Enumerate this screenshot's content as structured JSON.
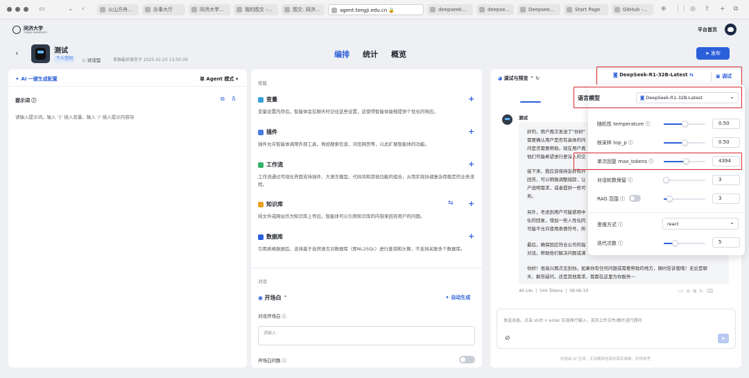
{
  "browser": {
    "tabs": [
      {
        "label": "火山方舟..."
      },
      {
        "label": "办事大厅"
      },
      {
        "label": "同济大学..."
      },
      {
        "label": "我的图文 -..."
      },
      {
        "label": "图文: 同济..."
      },
      {
        "label": "agent.tongji.edu.cn 🔒"
      },
      {
        "label": "deepseek..."
      },
      {
        "label": "deepse..."
      },
      {
        "label": "Deepsee..."
      },
      {
        "label": "Start Page"
      },
      {
        "label": "GitHub -..."
      }
    ]
  },
  "header": {
    "logo_text": "同济大学",
    "logo_sub": "TONGJI UNIVERSITY",
    "home_label": "平台首页"
  },
  "agent": {
    "name": "测试",
    "space_badge": "个人空间",
    "type_label": "对话型",
    "saved_text": "草稿最后保存于 2025-02-20 13:50:39"
  },
  "nav_tabs": [
    {
      "label": "编排"
    },
    {
      "label": "统计"
    },
    {
      "label": "概览"
    }
  ],
  "publish_label": "发布",
  "left": {
    "ai_config_label": "AI 一键生成配置",
    "mode_label": "单 Agent 模式",
    "prompt_title": "提示词 ⓘ",
    "prompt_placeholder": "请输入提示词，输入 '{' 插入变量、输入 '/' 插入提示内容块"
  },
  "skills": {
    "title": "技能",
    "items": [
      {
        "name": "变量",
        "desc": "变量设置内存后，智能体会在聊天时记住这些设置，这使得智能体能够提供个性化的响应。"
      },
      {
        "name": "插件",
        "desc": "插件允许智能体调用外部工具，例如搜索信息、浏览网页等，以此扩展智能体的功能。"
      },
      {
        "name": "工作流",
        "desc": "工作流通过可视化界面支持插件、大语言模型、代码块和其他功能的组合，从而实现协调复杂而稳定的业务流程。"
      },
      {
        "name": "知识库",
        "desc": "将文件或网站作为知识库上传后，智能体可以引用知识库的内容来回答用户的问题。"
      },
      {
        "name": "数据库",
        "desc": "引用表格数据后，支持基于自然语言对数据库（即NL2SQL）进行查询和计算，不支持关联多个数据库。"
      }
    ],
    "dialog_title": "对话",
    "opening_label": "开场白",
    "auto_gen_label": "自动生成",
    "opening_text_label": "对话开场白 ⓘ",
    "opening_placeholder": "请输入",
    "opening_q_label": "开场白问题 ⓘ"
  },
  "debug": {
    "title": "调试与预览",
    "model_name": "DeepSeek-R1-32B-Latest",
    "debug_label": "调试",
    "bot_name": "测试",
    "message": [
      "好的，用户再次发送了\"你好\"",
      "需要确认用户是否有具体的问",
      "问是否需要帮助。现在用户再",
      "他们可能希望进行更深入的交",
      "接下来，我应该保持友好和开",
      "回答，可以稍微调整措辞，让",
      "户说明需求，或者提供一些可",
      "务。",
      "另外，考虑到用户可能使用中",
      "化的回复，增加一些人性化的",
      "可能不允许使用表情符号，所",
      "最后，确保回应符合公司的指",
      "对话，帮助他们解决问题或满",
      "你好！很高兴再次见到你。如果你有任何问题或需要帮助的地方，随时告诉我哦！无论是聊",
      "天、解答疑问，还是其他需求，我都在这里为你服务～"
    ],
    "meta": "46.14s  |  544 Tokens  |  08:06:19",
    "input_placeholder": "发送消息。点击 shift + enter 实现换行输入，支持上传文件/图片进行提问",
    "disclaimer": "内容由 AI 生成，无法确保信息的真实准确，仅供参考"
  },
  "model_panel": {
    "lang_model_label": "语言模型",
    "model_value": "DeepSeek-R1-32B-Latest",
    "params": [
      {
        "label": "随机性 temperature ⓘ",
        "value": "0.50",
        "fraction": 0.5
      },
      {
        "label": "核采样 top_p ⓘ",
        "value": "0.50",
        "fraction": 0.5
      },
      {
        "label": "单次回复 max_tokens ⓘ",
        "value": "4394",
        "fraction": 0.53
      },
      {
        "label": "对话轮数保留 ⓘ",
        "value": "3",
        "fraction": 0.05
      },
      {
        "label": "RAG 范围 ⓘ",
        "value": "3",
        "fraction": 0.14
      }
    ],
    "thinking_label": "思维方式 ⓘ",
    "thinking_value": "react",
    "iter_label": "迭代次数 ⓘ",
    "iter_value": "5",
    "iter_fraction": 0.27
  },
  "colors": {
    "accent": "#2b5fd9",
    "highlight": "#d8262d"
  }
}
